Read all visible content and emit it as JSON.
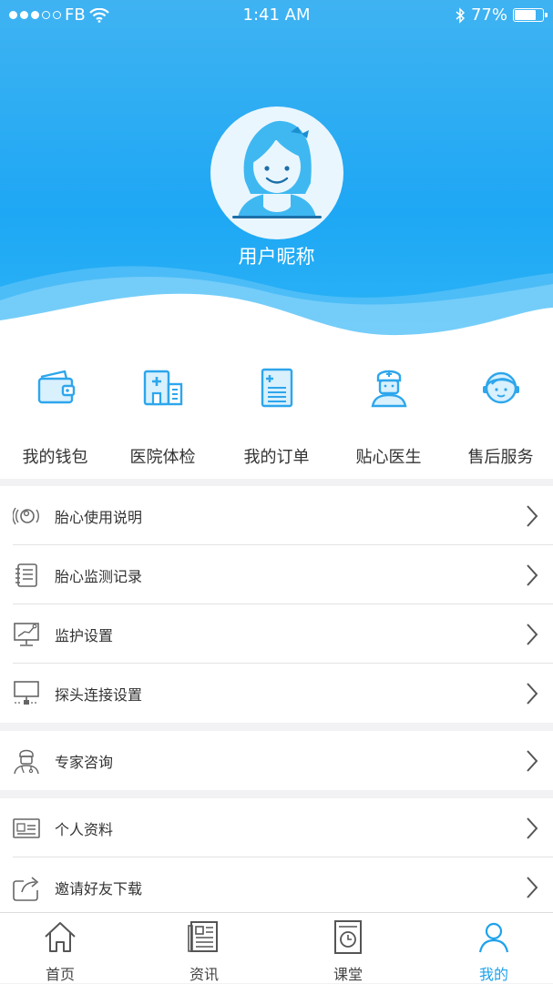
{
  "status_bar": {
    "carrier": "FB",
    "time": "1:41 AM",
    "battery": "77%",
    "battery_level": 0.77
  },
  "profile": {
    "nickname": "用户昵称"
  },
  "quick_actions": [
    {
      "label": "我的钱包",
      "icon": "wallet-icon"
    },
    {
      "label": "医院体检",
      "icon": "hospital-icon"
    },
    {
      "label": "我的订单",
      "icon": "order-icon"
    },
    {
      "label": "贴心医生",
      "icon": "doctor-icon"
    },
    {
      "label": "售后服务",
      "icon": "customer-service-icon"
    }
  ],
  "menu_groups": [
    [
      {
        "label": "胎心使用说明",
        "icon": "fetal-guide-icon"
      },
      {
        "label": "胎心监测记录",
        "icon": "record-book-icon"
      },
      {
        "label": "监护设置",
        "icon": "monitor-settings-icon"
      },
      {
        "label": "探头连接设置",
        "icon": "probe-connection-icon"
      }
    ],
    [
      {
        "label": "专家咨询",
        "icon": "expert-icon"
      }
    ],
    [
      {
        "label": "个人资料",
        "icon": "id-card-icon"
      },
      {
        "label": "邀请好友下载",
        "icon": "share-icon"
      }
    ]
  ],
  "tabs": [
    {
      "label": "首页",
      "icon": "home-icon"
    },
    {
      "label": "资讯",
      "icon": "news-icon"
    },
    {
      "label": "课堂",
      "icon": "classroom-icon"
    },
    {
      "label": "我的",
      "icon": "profile-icon",
      "active": true
    }
  ],
  "colors": {
    "accent": "#1ea2ec",
    "header": "#2aaef5"
  }
}
